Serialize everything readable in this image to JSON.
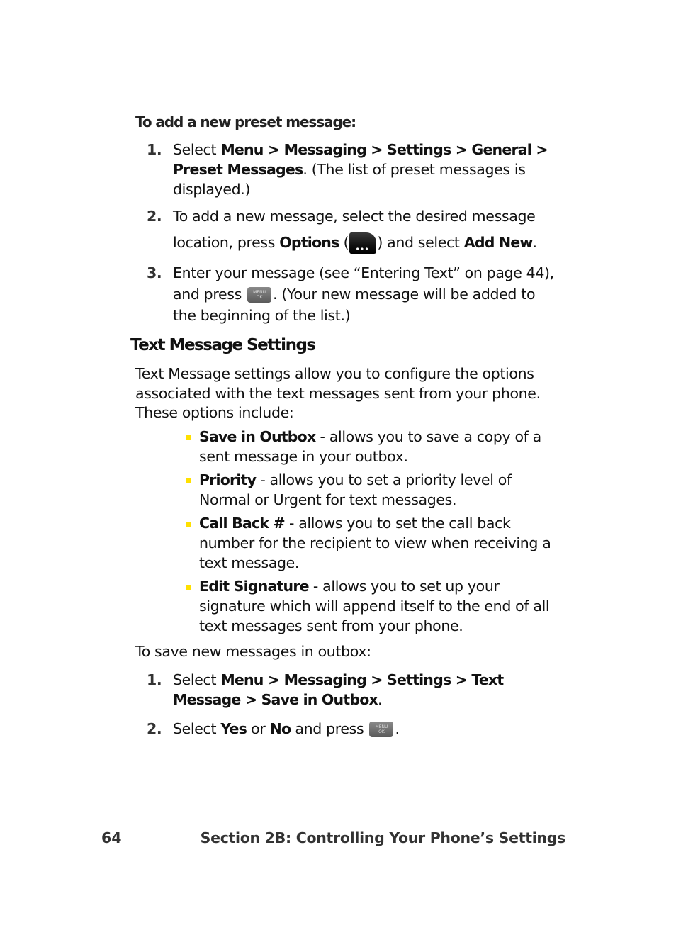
{
  "procedure1": {
    "title": "To add a new preset message:",
    "steps": [
      {
        "num": "1.",
        "t1": "Select ",
        "b1": "Menu > Messaging > Settings > General > Preset Messages",
        "t2": ". (The list of preset messages is displayed.)"
      },
      {
        "num": "2.",
        "t1": "To add a new message, select the desired message location, press ",
        "b1": "Options",
        "t2": " (",
        "t3": ") and select ",
        "b2": "Add New",
        "t4": "."
      },
      {
        "num": "3.",
        "t1": "Enter your message (see “Entering Text” on page 44), and press ",
        "t2": ". (Your new message will be added to the beginning of the list.)"
      }
    ]
  },
  "section": {
    "heading": "Text Message Settings",
    "intro": "Text Message settings allow you to configure the options associated with the text messages sent from your phone. These options include:",
    "bullet_color": "#ffe000",
    "bullets": [
      {
        "term": "Save in Outbox",
        "desc": " - allows you to save a copy of a sent message in your outbox."
      },
      {
        "term": "Priority",
        "desc": " - allows you to set a priority level of Normal or Urgent for text messages."
      },
      {
        "term": "Call Back #",
        "desc": " - allows you to set the call back number for the recipient to view when receiving a text message."
      },
      {
        "term": "Edit Signature",
        "desc": " - allows you to set up your signature which will append itself to the end of all text messages sent from your phone."
      }
    ]
  },
  "procedure2": {
    "title": "To save new messages in outbox:",
    "steps": [
      {
        "num": "1.",
        "t1": "Select ",
        "b1": "Menu > Messaging > Settings > Text Message > Save in Outbox",
        "t2": "."
      },
      {
        "num": "2.",
        "t1": "Select ",
        "b1": "Yes",
        "t2": " or ",
        "b2": "No",
        "t3": " and press ",
        "t4": "."
      }
    ]
  },
  "icons": {
    "options_key": "options-softkey-icon",
    "menu_ok_key": "menu-ok-key-icon",
    "menu_ok_line1": "MENU",
    "menu_ok_line2": "OK"
  },
  "footer": {
    "page_number": "64",
    "section_title": "Section 2B: Controlling Your Phone’s Settings"
  }
}
